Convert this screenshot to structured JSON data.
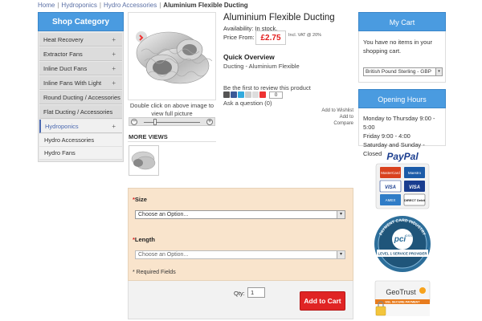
{
  "breadcrumb": {
    "items": [
      "Home",
      "Hydroponics",
      "Hydro Accessories"
    ],
    "current": "Aluminium Flexible Ducting"
  },
  "sidebar": {
    "title": "Shop Category",
    "categories": [
      {
        "label": "Heat Recovery",
        "has_children": true
      },
      {
        "label": "Extractor Fans",
        "has_children": true
      },
      {
        "label": "Inline Duct Fans",
        "has_children": true
      },
      {
        "label": "Inline Fans With Light",
        "has_children": true
      },
      {
        "label": "Round Ducting / Accessories",
        "has_children": false
      },
      {
        "label": "Flat Ducting / Accessories",
        "has_children": false
      },
      {
        "label": "Hydroponics",
        "has_children": true,
        "active": true
      }
    ],
    "plus_symbol": "+",
    "subcategories": [
      "Hydro Accessories",
      "Hydro Fans"
    ]
  },
  "product": {
    "title": "Aluminium Flexible Ducting",
    "availability": "Availability: In stock.",
    "price_label": "Price From:",
    "price": "£2.75",
    "vat_note": "Incl. VAT @ 20%",
    "overview_title": "Quick Overview",
    "overview_text": "Ducting - Aluminium Flexible",
    "review_text": "Be the first to review this product",
    "share_count": "0",
    "ask_question": "Ask a question (0)",
    "add_to_wishlist": "Add to Wishlist",
    "add_to_compare": "Add to Compare",
    "image_caption": "Double click on above image to view full picture",
    "zoom_out": "−",
    "zoom_in": "+",
    "more_views": "MORE VIEWS"
  },
  "options": {
    "required_mark": "*",
    "size_label": "Size",
    "size_value": "Choose an Option...",
    "length_label": "Length",
    "length_value": "Choose an Option...",
    "required_note": "* Required Fields",
    "arrow": "▾"
  },
  "cart_form": {
    "qty_label": "Qty:",
    "qty_value": "1",
    "add_to_cart": "Add to Cart"
  },
  "my_cart": {
    "title": "My Cart",
    "empty_text": "You have no items in your shopping cart.",
    "currency": "British Pound Sterling - GBP"
  },
  "opening_hours": {
    "title": "Opening Hours",
    "lines": [
      "Monday to Thursday 9:00 - 5:00",
      "Friday 9:00 - 4:00",
      "Saturday and Sunday - Closed"
    ]
  },
  "badges": {
    "paypal_text": "PayPal",
    "pci_ring_text": "PAYMENT CARD INDUSTRY",
    "pci_inner": "pci",
    "pci_dss": "DSS",
    "pci_level": "LEVEL 1 SERVICE PROVIDER",
    "geotrust": "GeoTrust",
    "geotrust_sub": "SSL SECURE PAYMENT",
    "cards": [
      "MasterCard",
      "Maestro",
      "VISA",
      "VISA",
      "AMEX",
      "DIRECT Debit"
    ]
  },
  "colors": {
    "accent_blue": "#4a9be0",
    "price_red": "#e21d1d",
    "options_bg": "#f9e4cc"
  }
}
